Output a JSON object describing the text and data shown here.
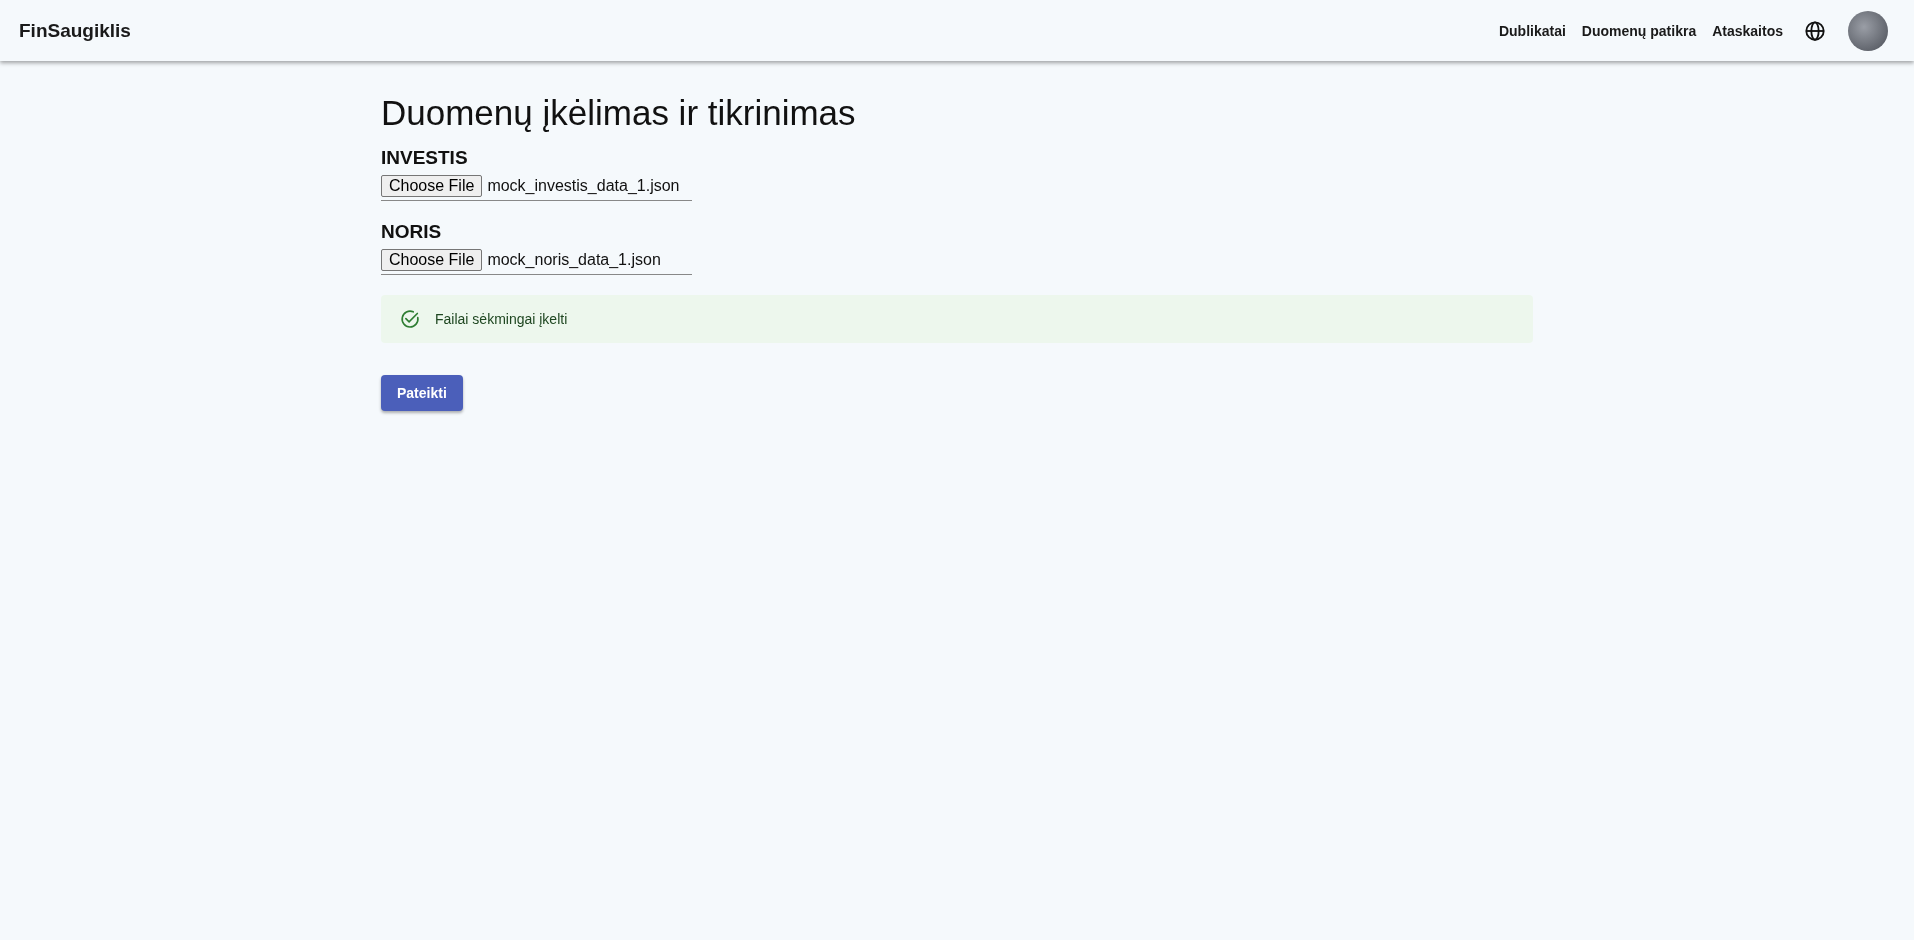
{
  "app_bar": {
    "brand": "FinSaugiklis",
    "nav": [
      {
        "label": "Dublikatai"
      },
      {
        "label": "Duomenų patikra"
      },
      {
        "label": "Ataskaitos"
      }
    ]
  },
  "page": {
    "title": "Duomenų įkėlimas ir tikrinimas",
    "uploads": [
      {
        "label": "INVESTIS",
        "button": "Choose File",
        "file_name": "mock_investis_data_1.json"
      },
      {
        "label": "NORIS",
        "button": "Choose File",
        "file_name": "mock_noris_data_1.json"
      }
    ],
    "alert": {
      "kind": "success",
      "message": "Failai sėkmingai įkelti"
    },
    "submit": "Pateikti"
  }
}
